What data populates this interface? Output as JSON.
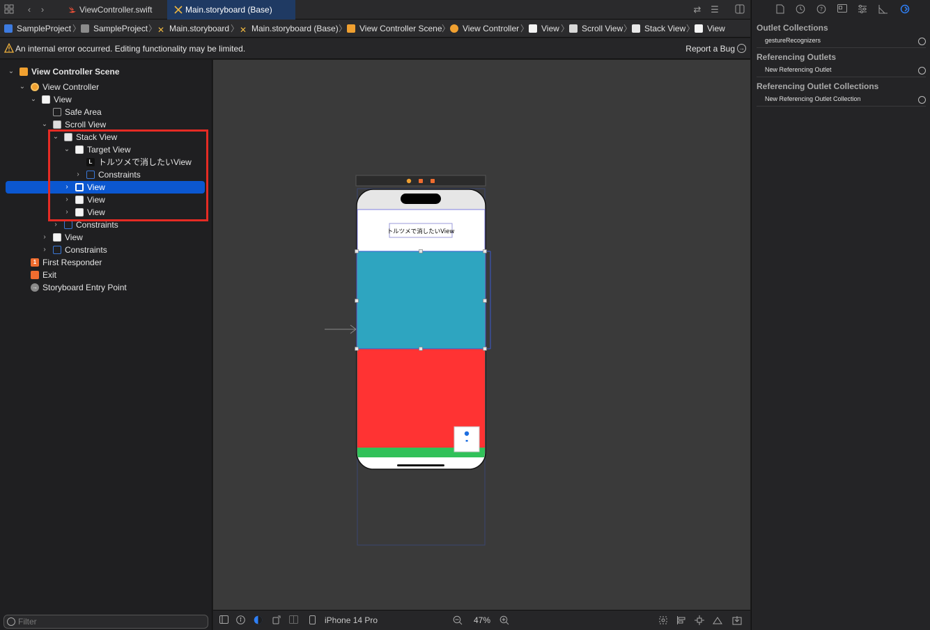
{
  "tabs": [
    {
      "label": "ViewController.swift",
      "active": false
    },
    {
      "label": "Main.storyboard (Base)",
      "active": true
    }
  ],
  "breadcrumb": [
    "SampleProject",
    "SampleProject",
    "Main.storyboard",
    "Main.storyboard (Base)",
    "View Controller Scene",
    "View Controller",
    "View",
    "Scroll View",
    "Stack View",
    "View"
  ],
  "warning": {
    "text": "An internal error occurred. Editing functionality may be limited.",
    "action": "Report a Bug"
  },
  "outline": [
    {
      "label": "View Controller Scene",
      "icon": "scene-icon",
      "bold": true
    },
    {
      "label": "View Controller",
      "icon": "view-controller-icon"
    },
    {
      "label": "View",
      "icon": "view-icon"
    },
    {
      "label": "Safe Area",
      "icon": "safe-area-icon"
    },
    {
      "label": "Scroll View",
      "icon": "scroll-view-icon"
    },
    {
      "label": "Stack View",
      "icon": "stack-view-icon"
    },
    {
      "label": "Target View",
      "icon": "view-icon"
    },
    {
      "label": "トルツメで消したいView",
      "icon": "label-icon"
    },
    {
      "label": "Constraints",
      "icon": "constraints-icon"
    },
    {
      "label": "View",
      "icon": "view-icon",
      "selected": true
    },
    {
      "label": "View",
      "icon": "view-icon"
    },
    {
      "label": "View",
      "icon": "view-icon"
    },
    {
      "label": "Constraints",
      "icon": "constraints-icon"
    },
    {
      "label": "View",
      "icon": "view-icon"
    },
    {
      "label": "Constraints",
      "icon": "constraints-icon"
    },
    {
      "label": "First Responder",
      "icon": "first-responder-icon"
    },
    {
      "label": "Exit",
      "icon": "exit-icon"
    },
    {
      "label": "Storyboard Entry Point",
      "icon": "entry-point-icon"
    }
  ],
  "filter": {
    "placeholder": "Filter",
    "value": ""
  },
  "device": {
    "label_text": "トルツメで消したいView",
    "colors": {
      "teal": "#2ea5c0",
      "red": "#ff3333",
      "green": "#31c159",
      "white": "#ffffff"
    }
  },
  "bottom_bar": {
    "device_name": "iPhone 14 Pro",
    "zoom": "47%"
  },
  "inspector": {
    "sections": [
      {
        "title": "Outlet Collections",
        "items": [
          "gestureRecognizers"
        ]
      },
      {
        "title": "Referencing Outlets",
        "items": [
          "New Referencing Outlet"
        ]
      },
      {
        "title": "Referencing Outlet Collections",
        "items": [
          "New Referencing Outlet Collection"
        ]
      }
    ]
  }
}
